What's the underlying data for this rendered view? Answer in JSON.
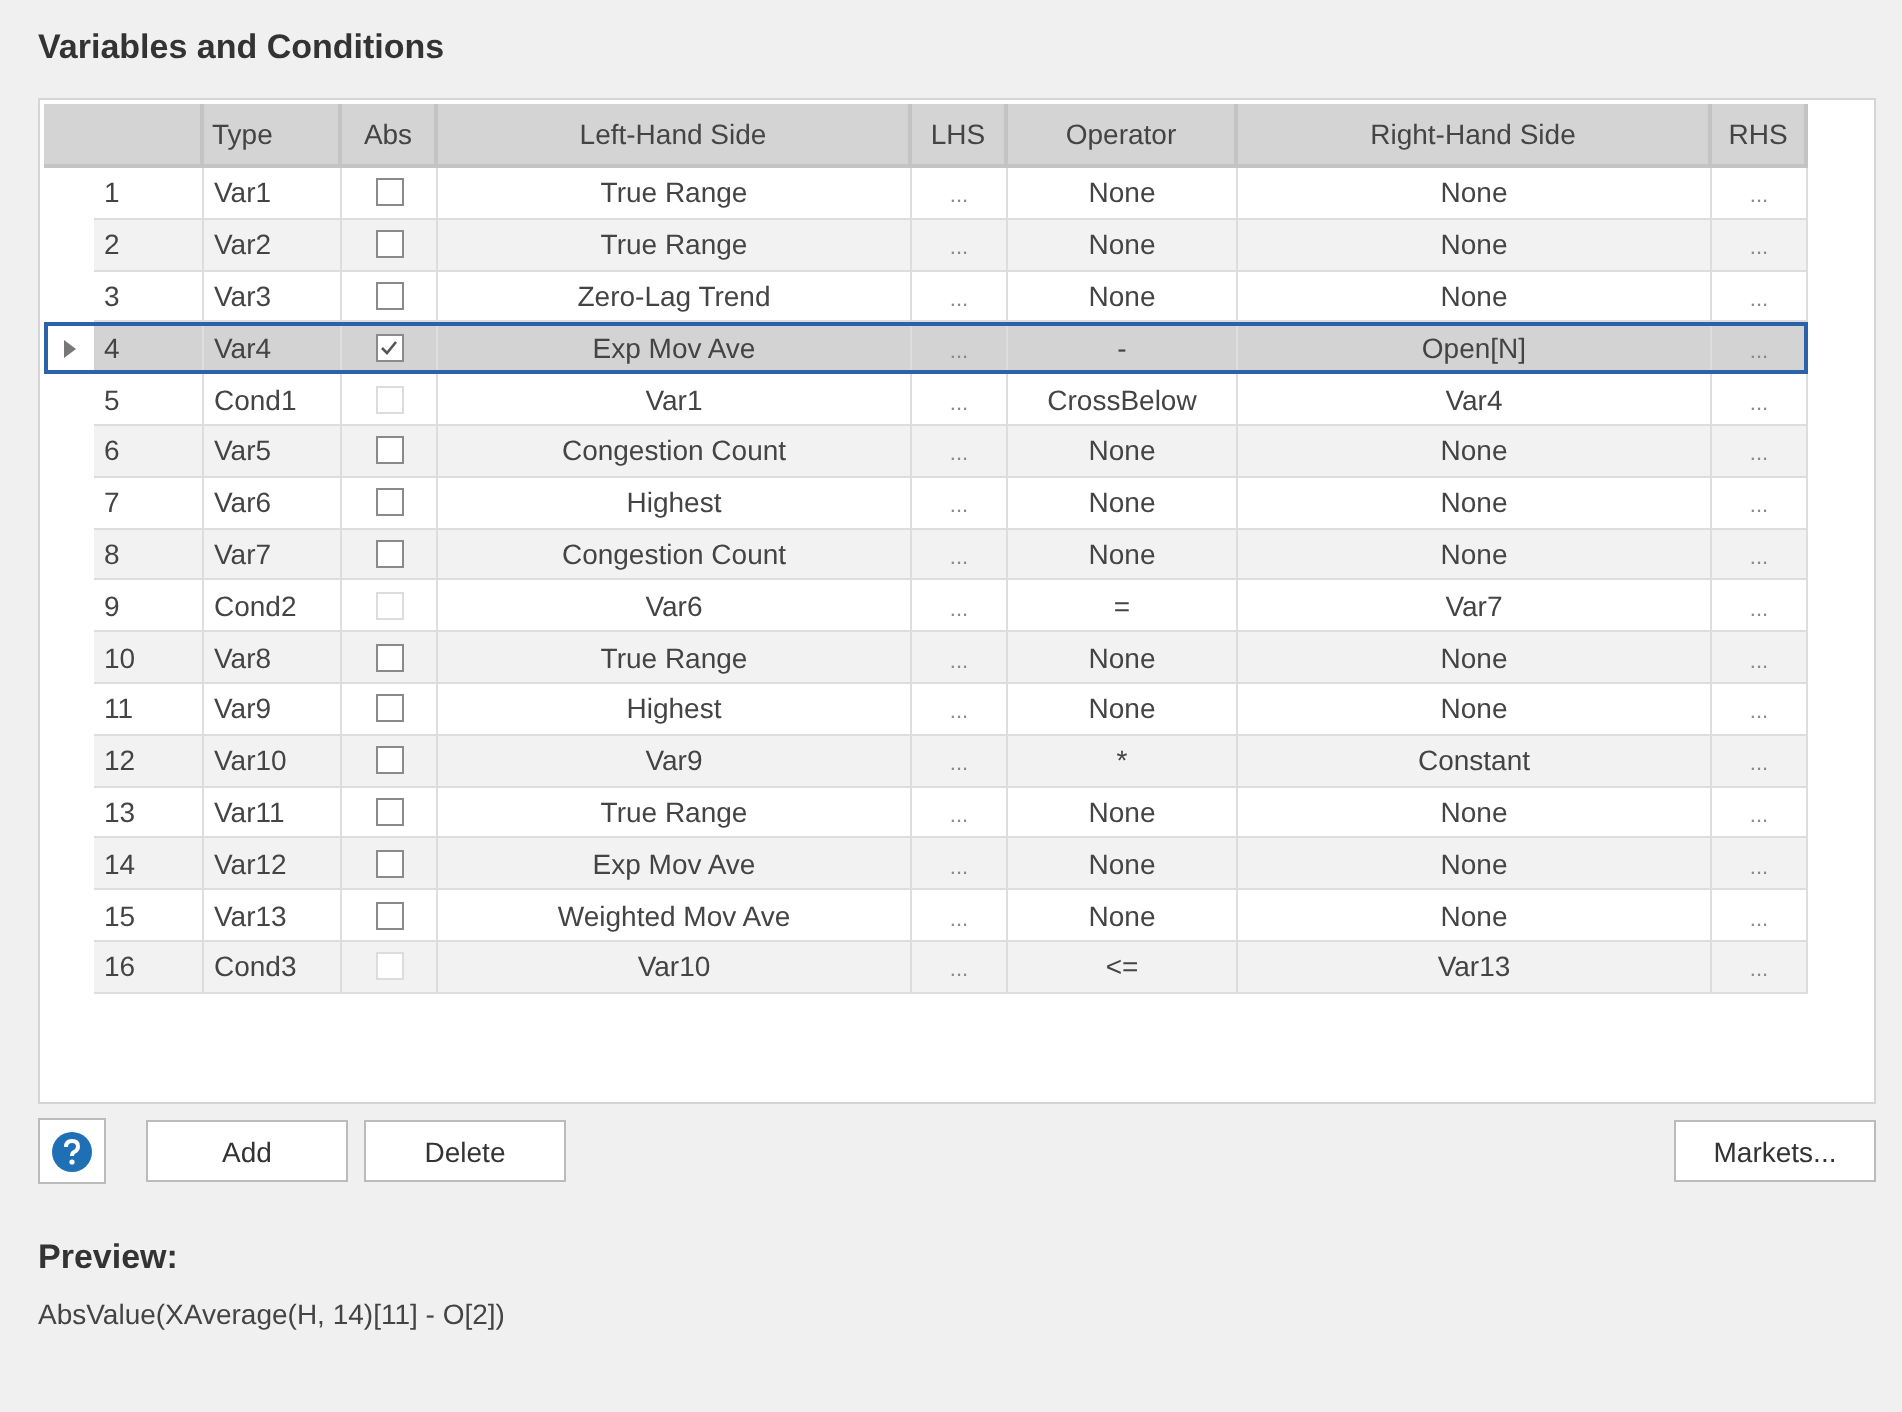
{
  "section_title": "Variables and Conditions",
  "table": {
    "columns": [
      "Type",
      "Abs",
      "Left-Hand Side",
      "LHS",
      "Operator",
      "Right-Hand Side",
      "RHS"
    ],
    "rows": [
      {
        "num": "1",
        "type": "Var1",
        "abs_checked": false,
        "abs_disabled": false,
        "lhs": "True Range",
        "lhs_button": "...",
        "operator": "None",
        "rhs": "None",
        "rhs_button": "...",
        "selected": false
      },
      {
        "num": "2",
        "type": "Var2",
        "abs_checked": false,
        "abs_disabled": false,
        "lhs": "True Range",
        "lhs_button": "...",
        "operator": "None",
        "rhs": "None",
        "rhs_button": "...",
        "selected": false
      },
      {
        "num": "3",
        "type": "Var3",
        "abs_checked": false,
        "abs_disabled": false,
        "lhs": "Zero-Lag Trend",
        "lhs_button": "...",
        "operator": "None",
        "rhs": "None",
        "rhs_button": "...",
        "selected": false
      },
      {
        "num": "4",
        "type": "Var4",
        "abs_checked": true,
        "abs_disabled": false,
        "lhs": "Exp Mov Ave",
        "lhs_button": "...",
        "operator": "-",
        "rhs": "Open[N]",
        "rhs_button": "...",
        "selected": true
      },
      {
        "num": "5",
        "type": "Cond1",
        "abs_checked": false,
        "abs_disabled": true,
        "lhs": "Var1",
        "lhs_button": "...",
        "operator": "CrossBelow",
        "rhs": "Var4",
        "rhs_button": "...",
        "selected": false
      },
      {
        "num": "6",
        "type": "Var5",
        "abs_checked": false,
        "abs_disabled": false,
        "lhs": "Congestion Count",
        "lhs_button": "...",
        "operator": "None",
        "rhs": "None",
        "rhs_button": "...",
        "selected": false
      },
      {
        "num": "7",
        "type": "Var6",
        "abs_checked": false,
        "abs_disabled": false,
        "lhs": "Highest",
        "lhs_button": "...",
        "operator": "None",
        "rhs": "None",
        "rhs_button": "...",
        "selected": false
      },
      {
        "num": "8",
        "type": "Var7",
        "abs_checked": false,
        "abs_disabled": false,
        "lhs": "Congestion Count",
        "lhs_button": "...",
        "operator": "None",
        "rhs": "None",
        "rhs_button": "...",
        "selected": false
      },
      {
        "num": "9",
        "type": "Cond2",
        "abs_checked": false,
        "abs_disabled": true,
        "lhs": "Var6",
        "lhs_button": "...",
        "operator": "=",
        "rhs": "Var7",
        "rhs_button": "...",
        "selected": false
      },
      {
        "num": "10",
        "type": "Var8",
        "abs_checked": false,
        "abs_disabled": false,
        "lhs": "True Range",
        "lhs_button": "...",
        "operator": "None",
        "rhs": "None",
        "rhs_button": "...",
        "selected": false
      },
      {
        "num": "11",
        "type": "Var9",
        "abs_checked": false,
        "abs_disabled": false,
        "lhs": "Highest",
        "lhs_button": "...",
        "operator": "None",
        "rhs": "None",
        "rhs_button": "...",
        "selected": false
      },
      {
        "num": "12",
        "type": "Var10",
        "abs_checked": false,
        "abs_disabled": false,
        "lhs": "Var9",
        "lhs_button": "...",
        "operator": "*",
        "rhs": "Constant",
        "rhs_button": "...",
        "selected": false
      },
      {
        "num": "13",
        "type": "Var11",
        "abs_checked": false,
        "abs_disabled": false,
        "lhs": "True Range",
        "lhs_button": "...",
        "operator": "None",
        "rhs": "None",
        "rhs_button": "...",
        "selected": false
      },
      {
        "num": "14",
        "type": "Var12",
        "abs_checked": false,
        "abs_disabled": false,
        "lhs": "Exp Mov Ave",
        "lhs_button": "...",
        "operator": "None",
        "rhs": "None",
        "rhs_button": "...",
        "selected": false
      },
      {
        "num": "15",
        "type": "Var13",
        "abs_checked": false,
        "abs_disabled": false,
        "lhs": "Weighted Mov Ave",
        "lhs_button": "...",
        "operator": "None",
        "rhs": "None",
        "rhs_button": "...",
        "selected": false
      },
      {
        "num": "16",
        "type": "Cond3",
        "abs_checked": false,
        "abs_disabled": true,
        "lhs": "Var10",
        "lhs_button": "...",
        "operator": "<=",
        "rhs": "Var13",
        "rhs_button": "...",
        "selected": false
      }
    ]
  },
  "buttons": {
    "add": "Add",
    "delete": "Delete",
    "markets": "Markets..."
  },
  "preview": {
    "label": "Preview:",
    "text": "AbsValue(XAverage(H, 14)[11] - O[2])"
  }
}
